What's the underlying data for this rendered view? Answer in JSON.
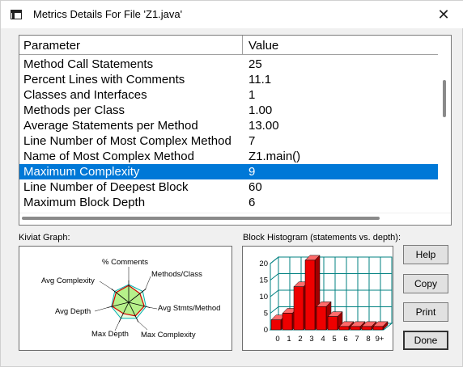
{
  "window": {
    "title": "Metrics Details For File 'Z1.java'"
  },
  "grid": {
    "headers": {
      "parameter": "Parameter",
      "value": "Value"
    },
    "rows": [
      {
        "parameter": "Method Call Statements",
        "value": "25"
      },
      {
        "parameter": "Percent Lines with Comments",
        "value": "11.1"
      },
      {
        "parameter": "Classes and Interfaces",
        "value": "1"
      },
      {
        "parameter": "Methods per Class",
        "value": "1.00"
      },
      {
        "parameter": "Average Statements per Method",
        "value": "13.00"
      },
      {
        "parameter": "Line Number of Most Complex Method",
        "value": "7"
      },
      {
        "parameter": "Name of Most Complex Method",
        "value": "Z1.main()"
      },
      {
        "parameter": "Maximum Complexity",
        "value": "9",
        "selected": true
      },
      {
        "parameter": "Line Number of Deepest Block",
        "value": "60"
      },
      {
        "parameter": "Maximum Block Depth",
        "value": "6"
      }
    ]
  },
  "kiviat": {
    "section_label": "Kiviat Graph:",
    "axes": [
      "% Comments",
      "Methods/Class",
      "Avg Stmts/Method",
      "Max Complexity",
      "Max Depth",
      "Avg Depth",
      "Avg Complexity"
    ]
  },
  "histogram": {
    "section_label": "Block Histogram (statements vs. depth):"
  },
  "chart_data": {
    "type": "bar",
    "categories": [
      "0",
      "1",
      "2",
      "3",
      "4",
      "5",
      "6",
      "7",
      "8",
      "9+"
    ],
    "values": [
      3,
      5,
      13,
      21,
      7,
      4,
      1,
      1,
      1,
      1
    ],
    "yticks": [
      "20",
      "15",
      "10",
      "5",
      "0"
    ],
    "ylim": [
      0,
      20
    ],
    "bar_color": "#ee0000",
    "grid_color": "#008080"
  },
  "buttons": {
    "help": "Help",
    "copy": "Copy",
    "print": "Print",
    "done": "Done"
  },
  "colors": {
    "selection": "#0078d7",
    "kiviat_fill": "#b6f08a"
  }
}
